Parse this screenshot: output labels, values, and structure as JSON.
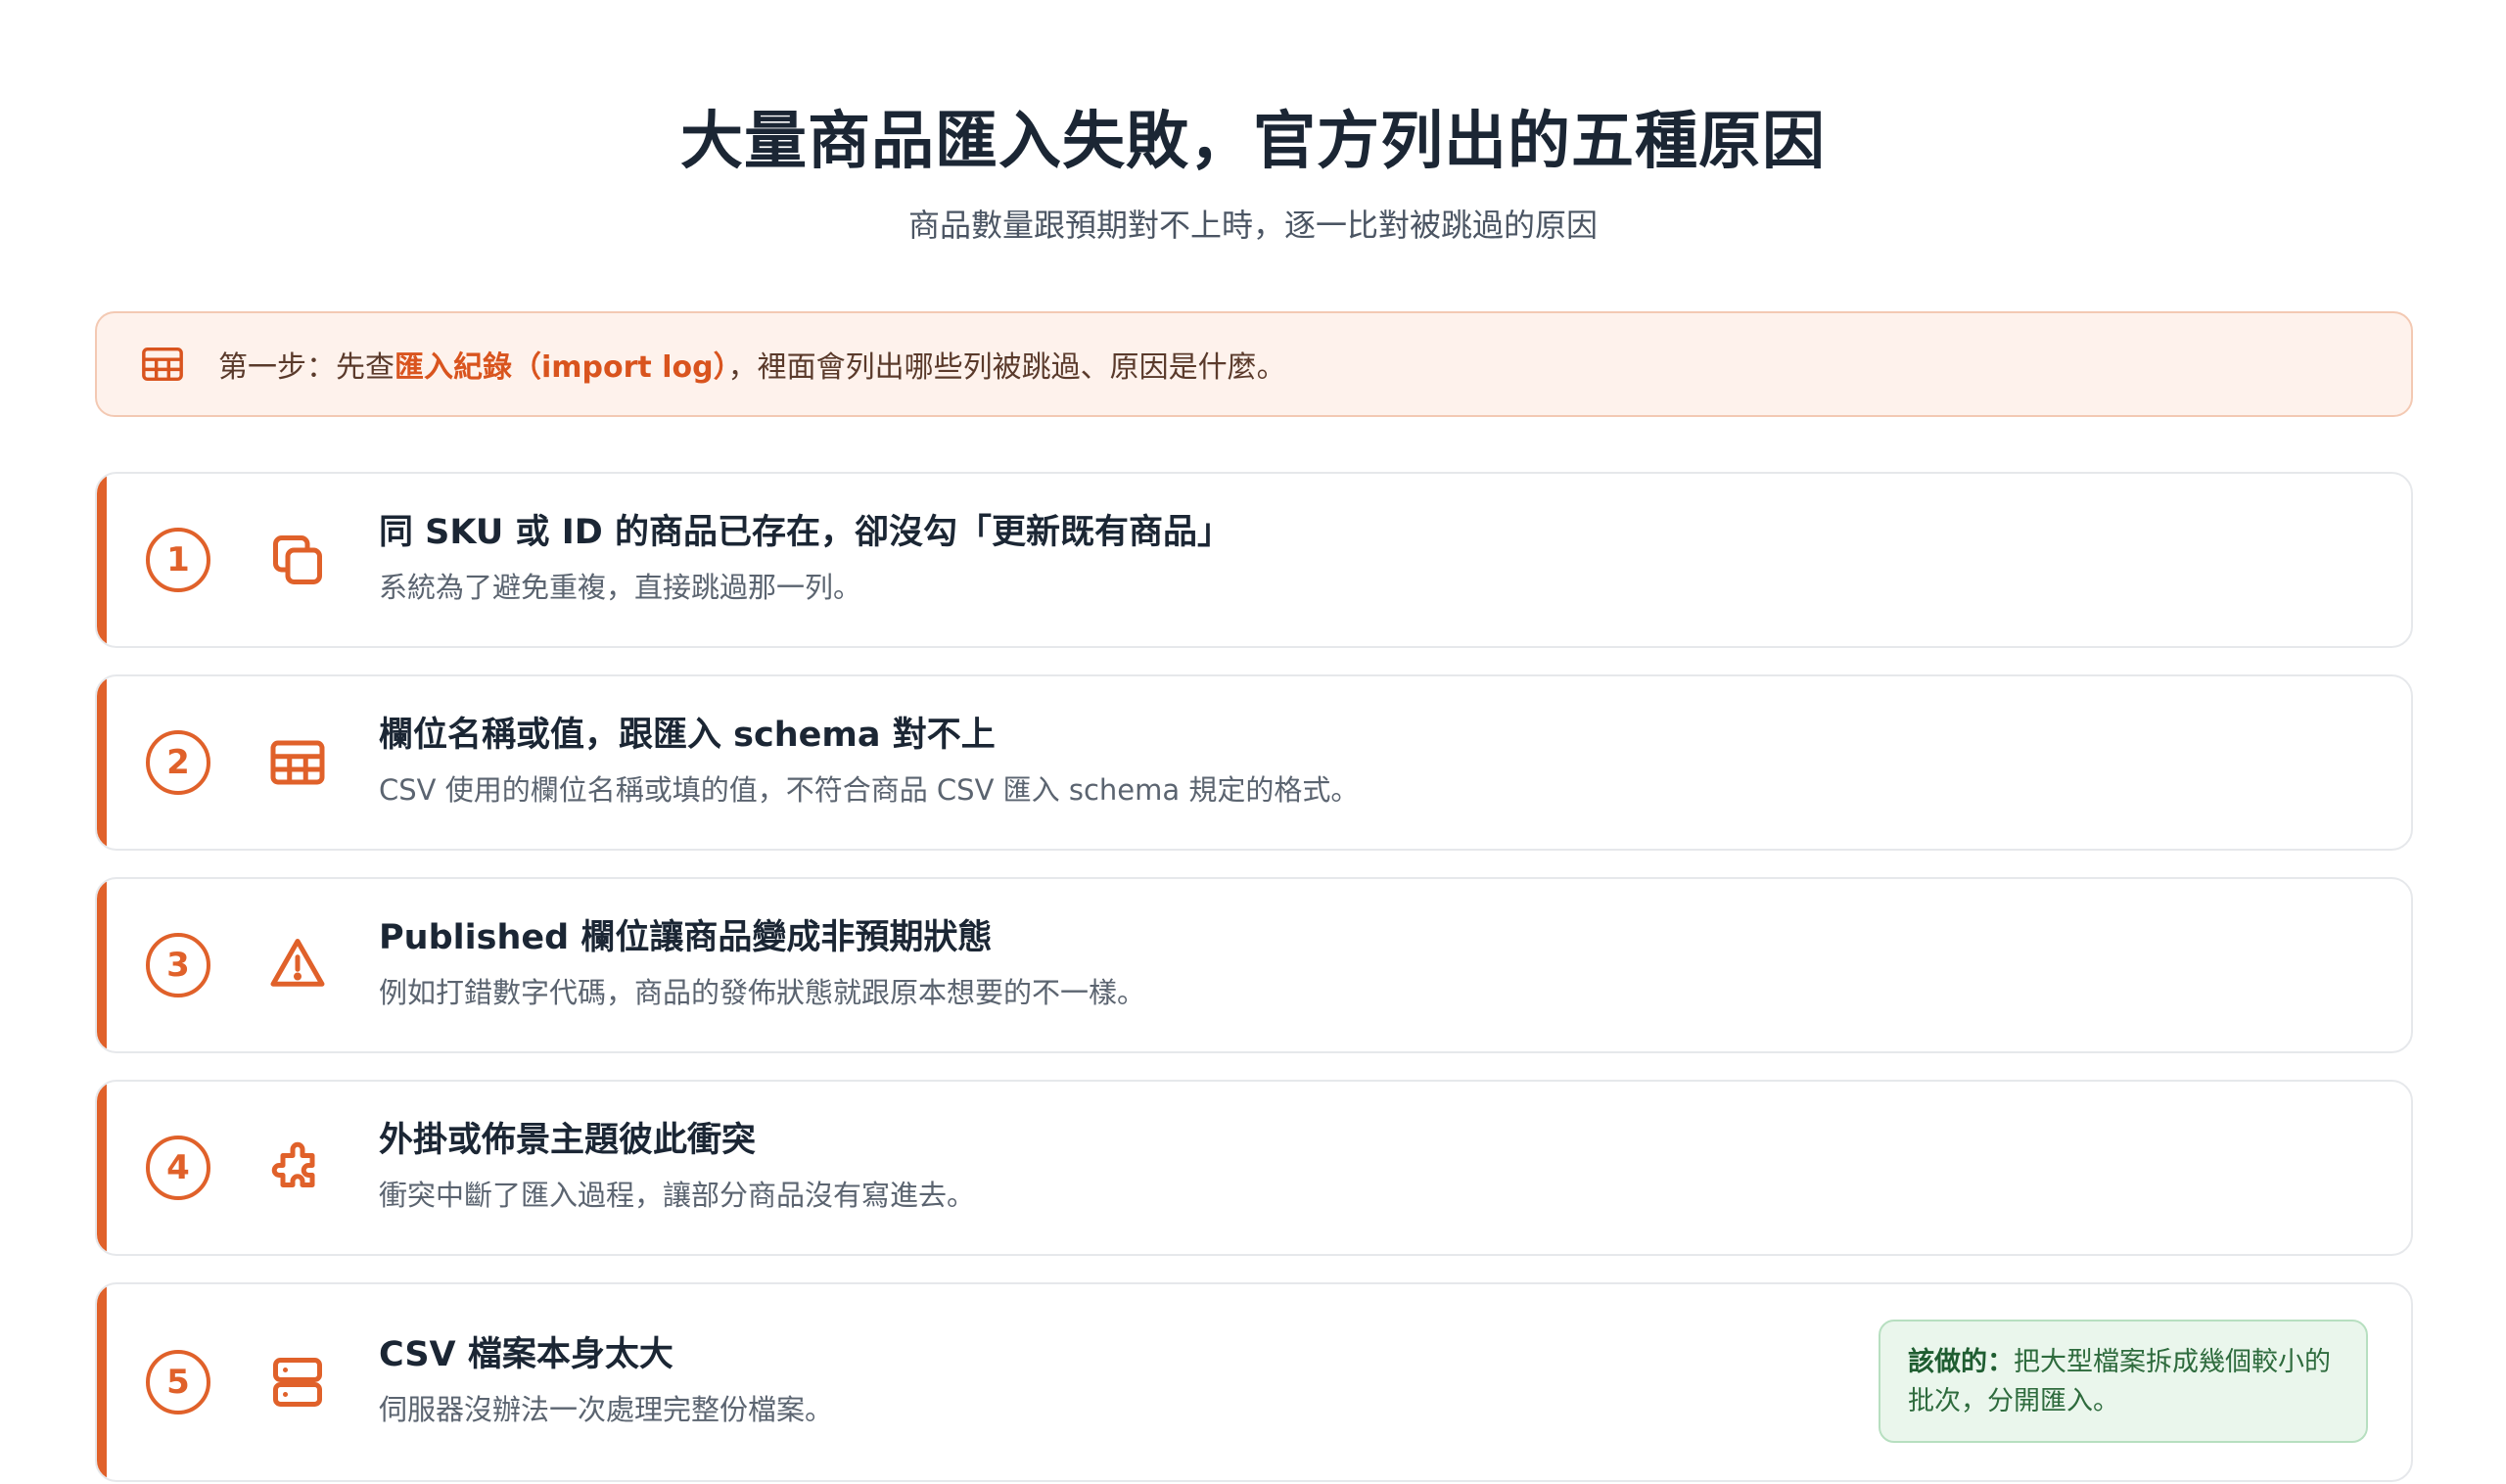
{
  "header": {
    "title": "大量商品匯入失敗，官方列出的五種原因",
    "subtitle": "商品數量跟預期對不上時，逐一比對被跳過的原因"
  },
  "notice": {
    "icon": "table-icon",
    "prefix": "第一步：先查",
    "highlight": "匯入紀錄（import log）",
    "suffix": "，裡面會列出哪些列被跳過、原因是什麼。"
  },
  "reasons": [
    {
      "number": "1",
      "icon": "copy-icon",
      "title": "同 SKU 或 ID 的商品已存在，卻沒勾「更新既有商品」",
      "description": "系統為了避免重複，直接跳過那一列。"
    },
    {
      "number": "2",
      "icon": "table-icon",
      "title": "欄位名稱或值，跟匯入 schema 對不上",
      "description": "CSV 使用的欄位名稱或填的值，不符合商品 CSV 匯入 schema 規定的格式。"
    },
    {
      "number": "3",
      "icon": "warning-icon",
      "title": "Published 欄位讓商品變成非預期狀態",
      "description": "例如打錯數字代碼，商品的發佈狀態就跟原本想要的不一樣。"
    },
    {
      "number": "4",
      "icon": "puzzle-icon",
      "title": "外掛或佈景主題彼此衝突",
      "description": "衝突中斷了匯入過程，讓部分商品沒有寫進去。"
    },
    {
      "number": "5",
      "icon": "server-icon",
      "title": "CSV 檔案本身太大",
      "description": "伺服器沒辦法一次處理完整份檔案。",
      "tip": {
        "label": "該做的：",
        "text": "把大型檔案拆成幾個較小的批次，分開匯入。"
      }
    }
  ],
  "colors": {
    "accent": "#e0612a",
    "notice_bg": "#fef2ec",
    "tip_bg": "#eaf6ec",
    "title": "#1b2634"
  }
}
